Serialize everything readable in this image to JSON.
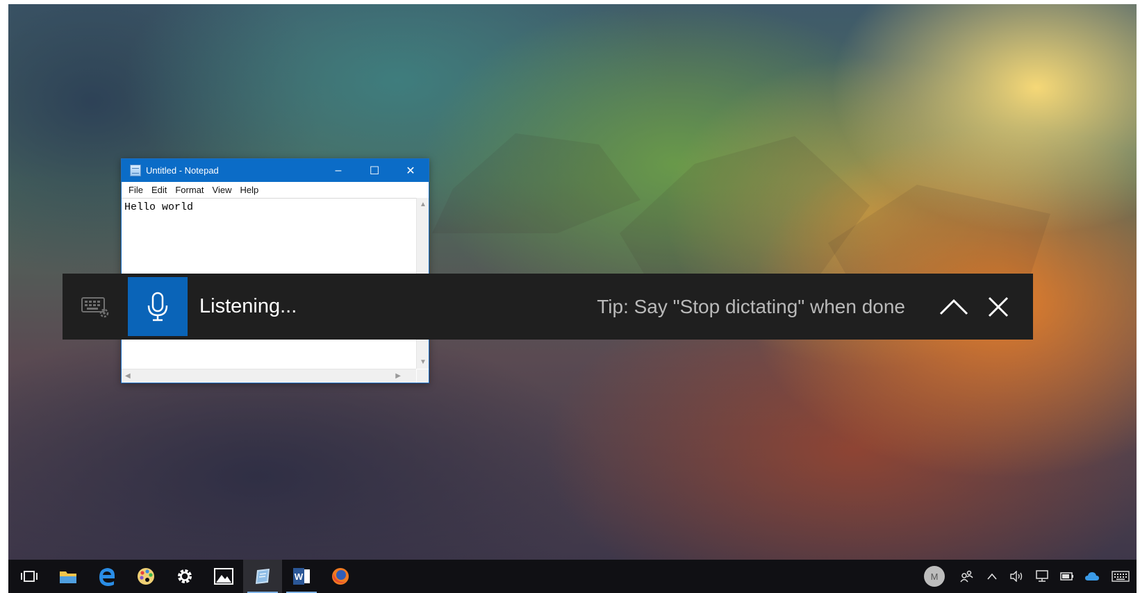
{
  "notepad": {
    "title": "Untitled - Notepad",
    "controls": {
      "minimize": "–",
      "maximize": "☐",
      "close": "✕"
    },
    "menu": [
      "File",
      "Edit",
      "Format",
      "View",
      "Help"
    ],
    "content": "Hello world"
  },
  "dictation": {
    "status": "Listening...",
    "tip": "Tip: Say \"Stop dictating\" when done",
    "icons": [
      "keyboard-settings-icon",
      "microphone-icon",
      "chevron-up-icon",
      "close-icon"
    ],
    "accent": "#0a64b8",
    "background": "#1f1f1f"
  },
  "taskbar": {
    "apps": [
      "task-view",
      "file-explorer",
      "edge",
      "paint",
      "settings",
      "photos",
      "notepad",
      "word",
      "firefox"
    ],
    "active_app": "notepad",
    "tray": {
      "avatar_letter": "M",
      "icons": [
        "people-icon",
        "show-hidden-icons",
        "volume-icon",
        "network-icon",
        "battery-icon",
        "onedrive-icon",
        "touch-keyboard-icon"
      ]
    }
  },
  "colors": {
    "title_bar": "#0b6cc7",
    "taskbar": "#101014"
  }
}
